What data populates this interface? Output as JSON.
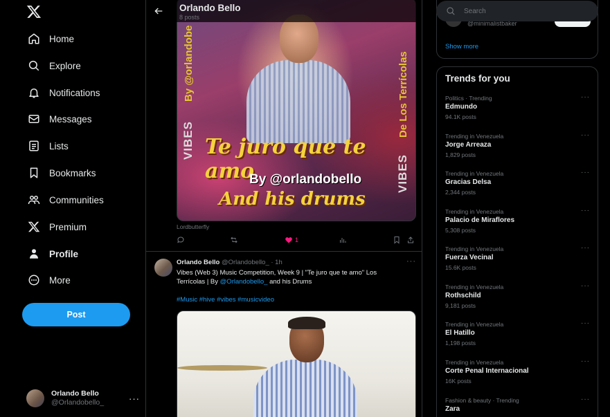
{
  "nav": {
    "items": [
      {
        "label": "Home",
        "icon": "home-icon"
      },
      {
        "label": "Explore",
        "icon": "search-icon"
      },
      {
        "label": "Notifications",
        "icon": "bell-icon"
      },
      {
        "label": "Messages",
        "icon": "mail-icon"
      },
      {
        "label": "Lists",
        "icon": "list-icon"
      },
      {
        "label": "Bookmarks",
        "icon": "bookmark-icon"
      },
      {
        "label": "Communities",
        "icon": "people-icon"
      },
      {
        "label": "Premium",
        "icon": "x-logo-icon"
      },
      {
        "label": "Profile",
        "icon": "person-icon"
      },
      {
        "label": "More",
        "icon": "more-circle-icon"
      }
    ],
    "post_label": "Post",
    "account": {
      "name": "Orlando Bello",
      "handle": "@Orlandobello_",
      "more": "···"
    }
  },
  "header": {
    "name": "Orlando Bello",
    "post_count": "8 posts"
  },
  "post1": {
    "image_texts": {
      "headline": "Te juro que te amo",
      "by": "By @orlandobello",
      "and_drums": "And his drums",
      "side_left": "By @orlandobe",
      "side_right": "De Los Terrícolas",
      "vibes": "VIBES"
    },
    "caption": "Lordbutterfly",
    "likes": "1"
  },
  "post2": {
    "name": "Orlando Bello",
    "handle": "@Orlandobello_",
    "time": "· 1h",
    "more": "···",
    "text_pre": "Vibes (Web 3) Music Competition, Week 9 | \"Te juro que te amo\" Los Terrícolas | By ",
    "text_link": "@Orlandobello_",
    "text_post": " and his Drums",
    "hashtags": "#Music #hive #vibes #musicvideo"
  },
  "right": {
    "search_placeholder": "Search",
    "who_to_follow_handle": "@minimalistbaker",
    "show_more": "Show more",
    "trends_title": "Trends for you",
    "trends": [
      {
        "context": "Politics · Trending",
        "title": "Edmundo",
        "count": "94.1K posts"
      },
      {
        "context": "Trending in Venezuela",
        "title": "Jorge Arreaza",
        "count": "1,829 posts"
      },
      {
        "context": "Trending in Venezuela",
        "title": "Gracias Delsa",
        "count": "2,344 posts"
      },
      {
        "context": "Trending in Venezuela",
        "title": "Palacio de Miraflores",
        "count": "5,308 posts"
      },
      {
        "context": "Trending in Venezuela",
        "title": "Fuerza Vecinal",
        "count": "15.6K posts"
      },
      {
        "context": "Trending in Venezuela",
        "title": "Rothschild",
        "count": "9,181 posts"
      },
      {
        "context": "Trending in Venezuela",
        "title": "El Hatillo",
        "count": "1,198 posts"
      },
      {
        "context": "Trending in Venezuela",
        "title": "Corte Penal Internacional",
        "count": "16K posts"
      },
      {
        "context": "Fashion & beauty · Trending",
        "title": "Zara",
        "count": ""
      }
    ]
  },
  "colors": {
    "accent": "#1d9bf0",
    "like": "#f91880",
    "border": "#2f3336",
    "muted": "#71767b"
  }
}
